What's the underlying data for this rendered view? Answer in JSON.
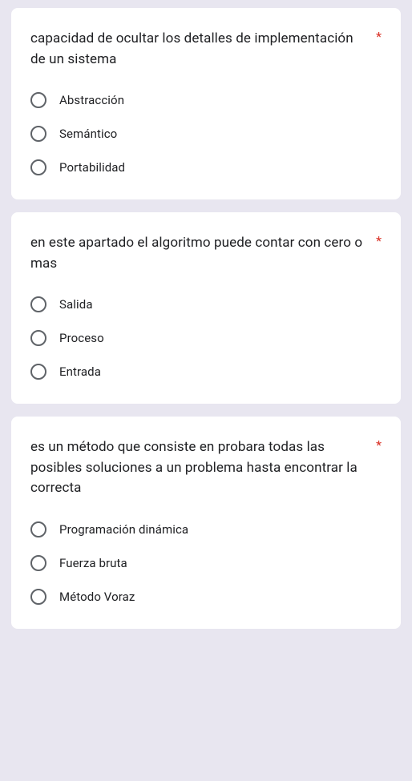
{
  "questions": [
    {
      "text": "capacidad de ocultar los detalles de implementación de un sistema",
      "required": "*",
      "options": [
        {
          "label": "Abstracción"
        },
        {
          "label": "Semántico"
        },
        {
          "label": "Portabilidad"
        }
      ]
    },
    {
      "text": "en este apartado el algoritmo puede contar con cero o mas",
      "required": "*",
      "options": [
        {
          "label": "Salida"
        },
        {
          "label": "Proceso"
        },
        {
          "label": "Entrada"
        }
      ]
    },
    {
      "text": "es un método que consiste en probara todas las posibles soluciones a un problema hasta encontrar la correcta",
      "required": "*",
      "options": [
        {
          "label": "Programación dinámica"
        },
        {
          "label": "Fuerza bruta"
        },
        {
          "label": "Método Voraz"
        }
      ]
    }
  ]
}
